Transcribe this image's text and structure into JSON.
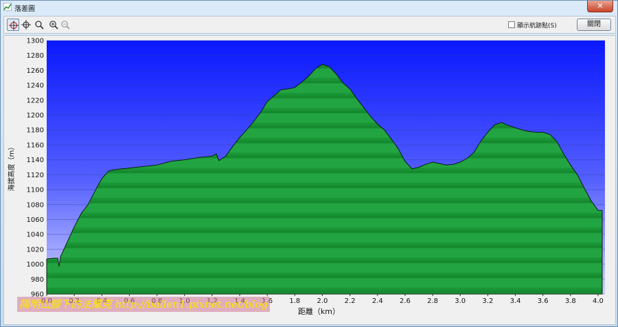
{
  "window": {
    "title": "落差圖",
    "close_glyph": "✕",
    "title_icon": "chart-icon"
  },
  "toolbar": {
    "tools": [
      {
        "name": "pan-crosshair-icon",
        "glyph": "⌖"
      },
      {
        "name": "crosshair-icon",
        "glyph": "⌖"
      },
      {
        "name": "zoom-rect-icon",
        "glyph": "⌕"
      },
      {
        "name": "zoom-in-icon",
        "glyph": "⊕"
      },
      {
        "name": "zoom-out-icon",
        "glyph": "⊖"
      }
    ],
    "show_track_points_label": "顯示航跡點(S)",
    "show_track_points_checked": false,
    "close_label": "關閉"
  },
  "watermark": {
    "text": "陽明山腳下的法蘭克 http://ballen1.pixnet.net/blog"
  },
  "chart_data": {
    "type": "area",
    "title": "",
    "xlabel": "距離（km）",
    "ylabel": "海拔高度（m）",
    "xlim": [
      0,
      4.05
    ],
    "ylim": [
      960,
      1300
    ],
    "x_ticks": [
      "0.0",
      "0.2",
      "0.4",
      "0.6",
      "0.8",
      "1.0",
      "1.2",
      "1.4",
      "1.6",
      "1.8",
      "2.0",
      "2.2",
      "2.4",
      "2.6",
      "2.8",
      "3.0",
      "3.2",
      "3.4",
      "3.6",
      "3.8",
      "4.0"
    ],
    "y_ticks": [
      "960",
      "980",
      "1000",
      "1020",
      "1040",
      "1060",
      "1080",
      "1100",
      "1120",
      "1140",
      "1160",
      "1180",
      "1200",
      "1220",
      "1240",
      "1260",
      "1280",
      "1300"
    ],
    "grid": true,
    "colors": {
      "fill": "#1e9e3c",
      "fill_dark": "#0d6e22",
      "bg_top": "#0a20ff",
      "bg_bottom": "#c8ccff",
      "line": "#0a1a0a"
    },
    "series": [
      {
        "x": [
          0.0,
          0.05,
          0.08,
          0.09,
          0.1,
          0.15,
          0.2,
          0.25,
          0.3,
          0.35,
          0.4,
          0.45,
          0.5,
          0.6,
          0.7,
          0.8,
          0.9,
          1.0,
          1.1,
          1.2,
          1.23,
          1.25,
          1.3,
          1.35,
          1.4,
          1.45,
          1.5,
          1.55,
          1.6,
          1.65,
          1.7,
          1.75,
          1.8,
          1.85,
          1.9,
          1.95,
          2.0,
          2.05,
          2.1,
          2.15,
          2.2,
          2.25,
          2.3,
          2.35,
          2.4,
          2.45,
          2.5,
          2.55,
          2.6,
          2.65,
          2.7,
          2.75,
          2.8,
          2.85,
          2.9,
          2.95,
          3.0,
          3.05,
          3.1,
          3.15,
          3.2,
          3.25,
          3.3,
          3.35,
          3.4,
          3.45,
          3.5,
          3.55,
          3.6,
          3.65,
          3.7,
          3.75,
          3.8,
          3.85,
          3.9,
          3.95,
          4.0,
          4.03
        ],
        "y": [
          1007,
          1008,
          1008,
          997,
          1010,
          1030,
          1050,
          1068,
          1080,
          1098,
          1115,
          1125,
          1127,
          1129,
          1131,
          1133,
          1138,
          1140,
          1143,
          1145,
          1148,
          1139,
          1145,
          1158,
          1170,
          1180,
          1191,
          1203,
          1218,
          1226,
          1234,
          1235,
          1237,
          1244,
          1252,
          1262,
          1268,
          1265,
          1255,
          1243,
          1235,
          1222,
          1210,
          1198,
          1188,
          1180,
          1168,
          1155,
          1138,
          1128,
          1130,
          1134,
          1137,
          1135,
          1133,
          1134,
          1137,
          1142,
          1150,
          1165,
          1177,
          1187,
          1190,
          1186,
          1183,
          1180,
          1178,
          1177,
          1177,
          1174,
          1165,
          1148,
          1133,
          1120,
          1102,
          1085,
          1072,
          1072
        ]
      }
    ]
  }
}
